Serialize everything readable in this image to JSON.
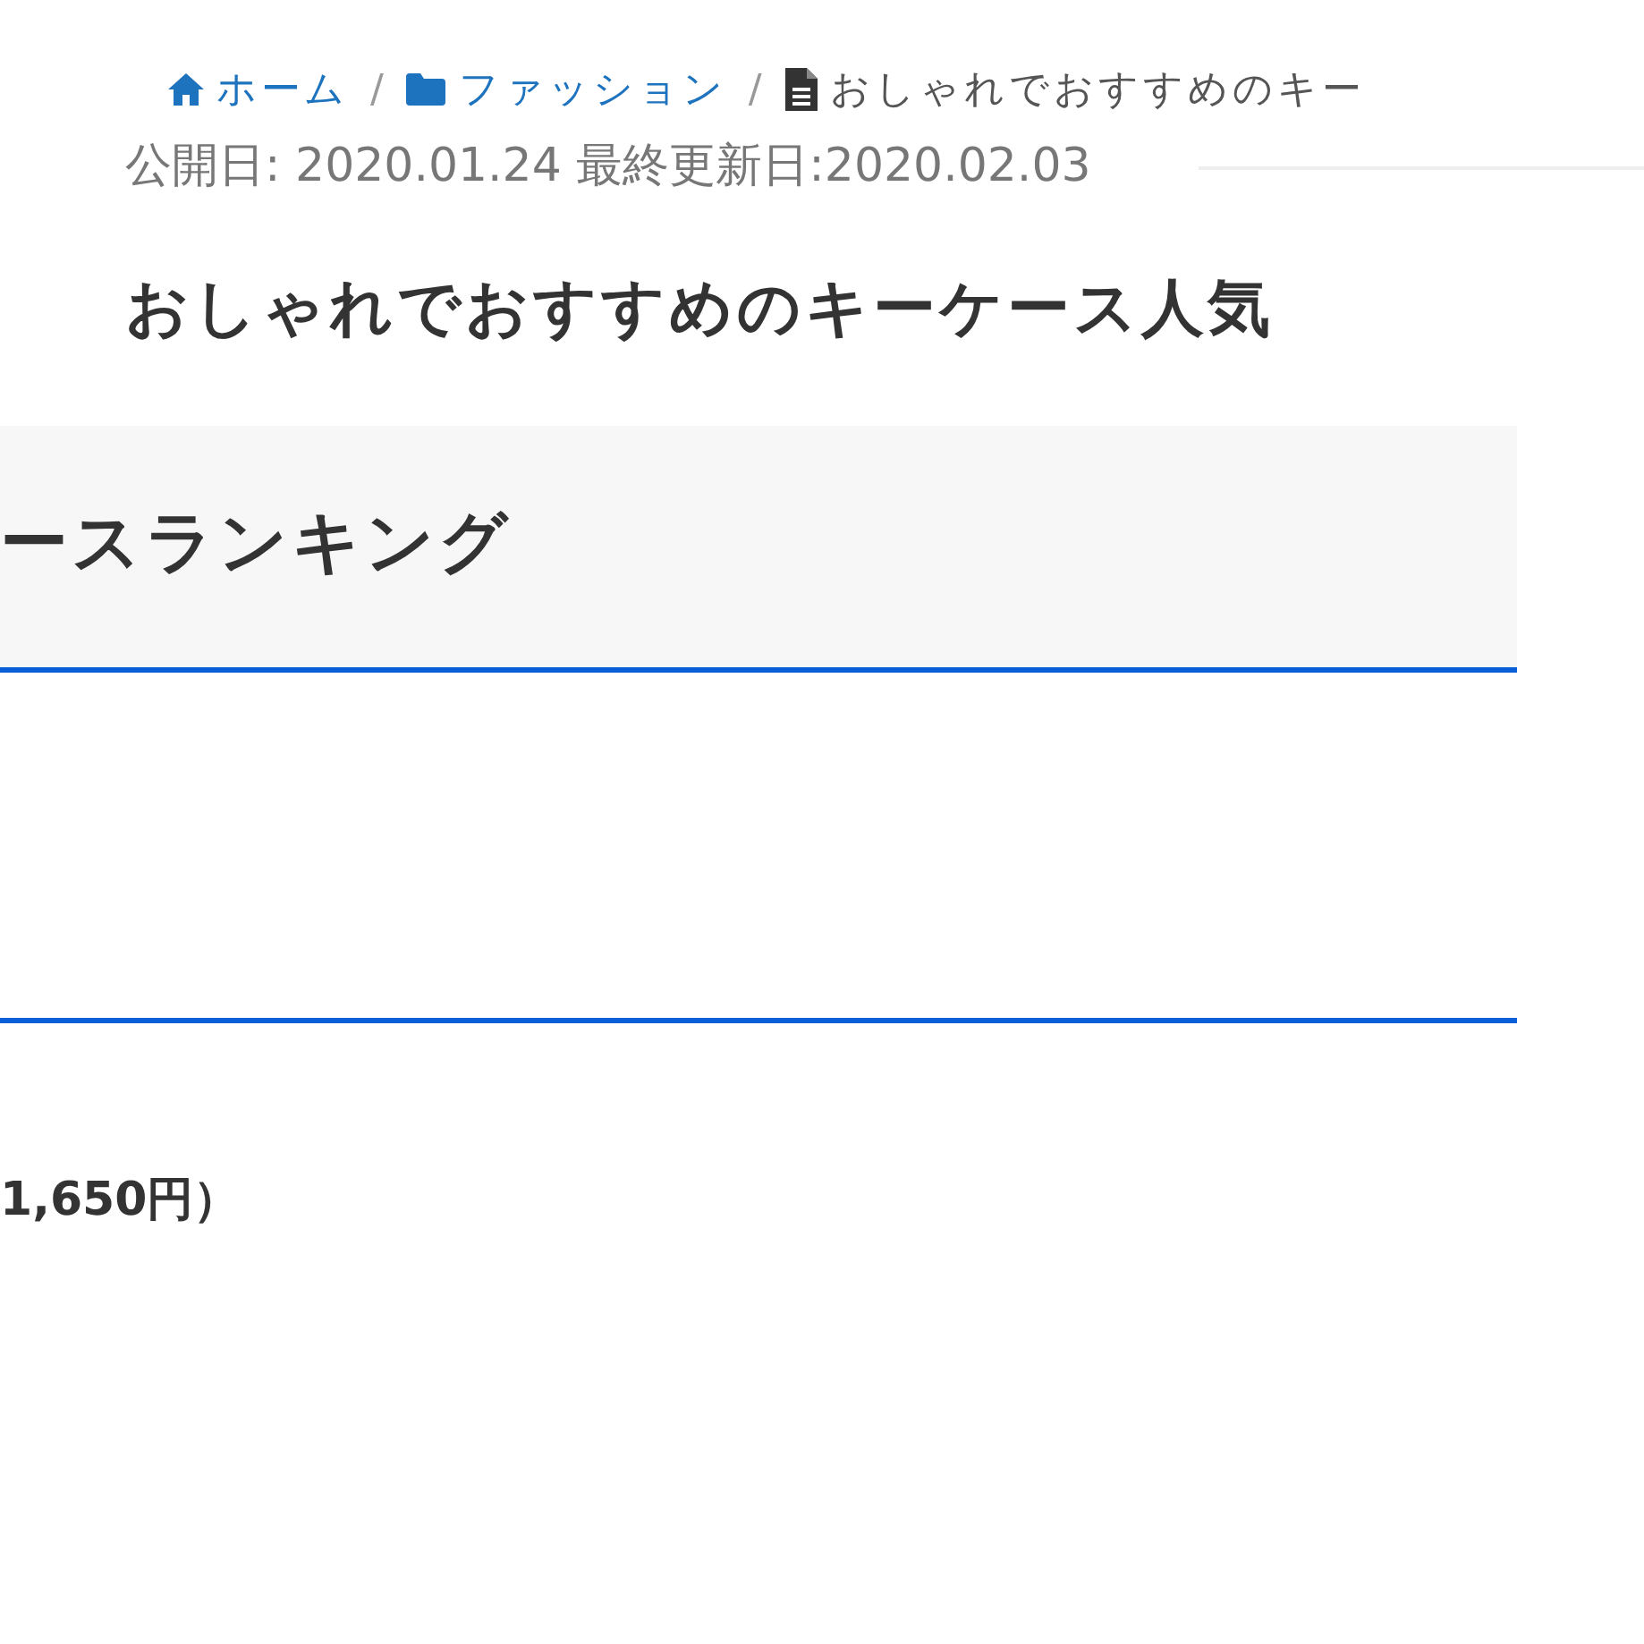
{
  "breadcrumb": [
    {
      "kind": "home",
      "label": "ホーム",
      "separator": "/"
    },
    {
      "kind": "folder",
      "label": "ファッション",
      "separator": "/"
    },
    {
      "kind": "page",
      "label": "おしゃれでおすすめのキー"
    }
  ],
  "dates": "公開日: 2020.01.24 最終更新日:2020.02.03",
  "title": "おしゃれでおすすめのキーケース人気",
  "section_heading": "ースランキング",
  "price_text": "1,650円）"
}
